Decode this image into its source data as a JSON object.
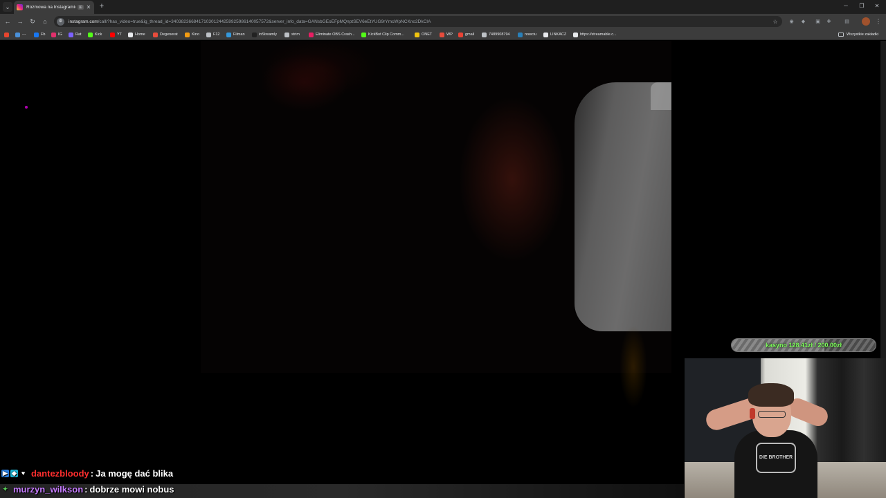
{
  "browser": {
    "tab_title": "Rozmowa na Instagramie",
    "tab_media_badge": "⊞",
    "url_host": "instagram.com",
    "url_path": "/call/?has_video=true&ig_thread_id=340382366841710301244259925986140057572&server_info_data=GANsbGEoEFpMQnptSEV6eEtYUG9rYmcWpNCKno2DkCIA",
    "bookmarks": [
      {
        "label": "Fb",
        "color": "#1877f2"
      },
      {
        "label": "IG",
        "color": "#e1306c"
      },
      {
        "label": "Rat",
        "color": "#7b61ff"
      },
      {
        "label": "Kick",
        "color": "#53fc18"
      },
      {
        "label": "YT",
        "color": "#ff0000"
      },
      {
        "label": "Home",
        "color": "#e8eaed"
      },
      {
        "label": "Degenerat",
        "color": "#e74c3c"
      },
      {
        "label": "Kino",
        "color": "#f39c12"
      },
      {
        "label": "F12",
        "color": "#bdc1c6"
      },
      {
        "label": "Filman",
        "color": "#3498db"
      },
      {
        "label": "inStreamly",
        "color": "#222222"
      },
      {
        "label": "strim",
        "color": "#bdc1c6"
      },
      {
        "label": "Eliminate OBS Crash...",
        "color": "#e91e63"
      },
      {
        "label": "KickBot Clip Comm...",
        "color": "#53fc18"
      },
      {
        "label": "ONET",
        "color": "#f1c40f"
      },
      {
        "label": "WP",
        "color": "#e74c3c"
      },
      {
        "label": "gmail",
        "color": "#ea4335"
      },
      {
        "label": "7489908794",
        "color": "#bdc1c6"
      },
      {
        "label": "nowciu",
        "color": "#2980b9"
      },
      {
        "label": "LINKACZ",
        "color": "#e8eaed"
      },
      {
        "label": "https://streamable.c...",
        "color": "#e8eaed"
      }
    ],
    "all_bookmarks_label": "Wszystkie zakładki"
  },
  "overlay": {
    "goal_text": "kasyno 128.41zł / 200.00zł",
    "goal_progress": 0.64205,
    "cam_shirt_logo": "DIE BROTHER"
  },
  "chat": [
    {
      "user": "dantezbloody",
      "user_color": "#ff2e2e",
      "message": "Ja mogę dać blika"
    },
    {
      "user": "murzyn_wiIkson",
      "user_color": "#c77dff",
      "message": "dobrze mowi nobus"
    }
  ]
}
